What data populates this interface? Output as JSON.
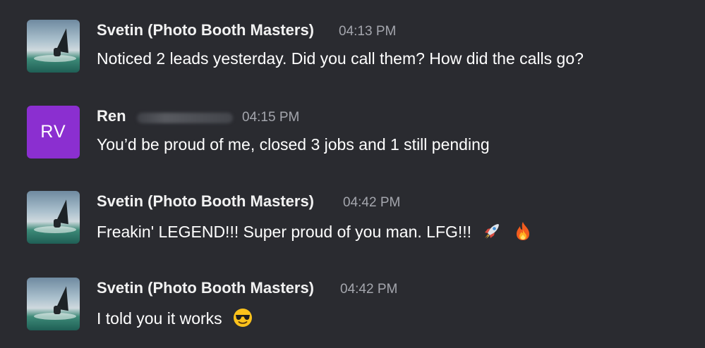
{
  "messages": [
    {
      "author": "Svetin (Photo Booth Masters)",
      "time": "04:13 PM",
      "text": "Noticed 2 leads yesterday. Did you call them? How did the calls go?",
      "avatar": "photo"
    },
    {
      "author": "Ren",
      "time": "04:15 PM",
      "text": "You’d be proud of me, closed 3 jobs and 1 still pending",
      "avatar": "initials",
      "avatar_initials": "RV",
      "avatar_color": "#8b2fd0"
    },
    {
      "author": "Svetin (Photo Booth Masters)",
      "time": "04:42 PM",
      "text": "Freakin' LEGEND!!! Super proud of you man. LFG!!!",
      "emojis": [
        "rocket-emoji",
        "fire-emoji"
      ],
      "avatar": "photo"
    },
    {
      "author": "Svetin (Photo Booth Masters)",
      "time": "04:42 PM",
      "text": "I told you it works",
      "emojis": [
        "sunglasses-emoji"
      ],
      "avatar": "photo"
    }
  ],
  "colors": {
    "background": "#2a2b30",
    "timestamp": "#a4a6ad",
    "avatar_purple": "#8b2fd0"
  }
}
